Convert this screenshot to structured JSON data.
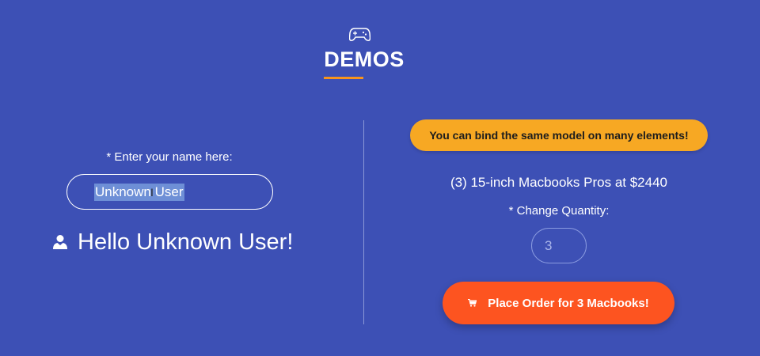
{
  "header": {
    "icon": "gamepad-icon",
    "title": "DEMOS",
    "accent_color": "#f7941d"
  },
  "left": {
    "name_label": "* Enter your name here:",
    "name_input_value": "Unknown User",
    "greeting_icon": "user-icon",
    "greeting_text": "Hello Unknown User!"
  },
  "right": {
    "info_pill_text": "You can bind the same model on many elements!",
    "order_summary": "(3) 15-inch Macbooks Pros at $2440",
    "quantity_label": "* Change Quantity:",
    "quantity_value": "3",
    "order_button_icon": "cart-icon",
    "order_button_label": "Place Order for 3 Macbooks!"
  },
  "colors": {
    "background": "#3d50b5",
    "pill": "#f7a823",
    "button": "#fd5420"
  }
}
